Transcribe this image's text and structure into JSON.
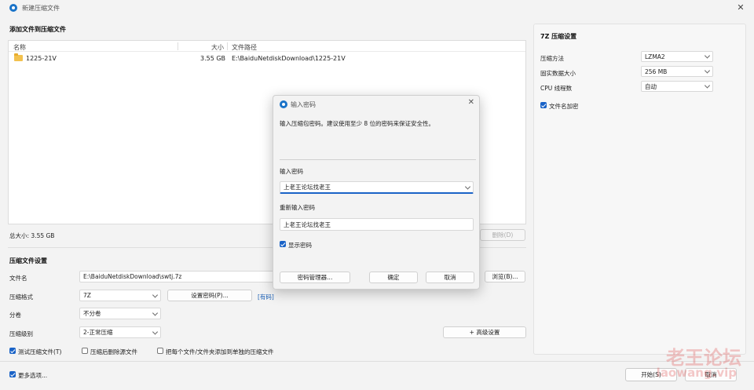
{
  "window": {
    "title": "新建压缩文件"
  },
  "file_section": {
    "title": "添加文件到压缩文件",
    "columns": {
      "name": "名称",
      "size": "大小",
      "path": "文件路径"
    },
    "rows": [
      {
        "name": "1225-21V",
        "size": "3.55 GB",
        "path": "E:\\BaiduNetdiskDownload\\1225-21V"
      }
    ],
    "total_size": "总大小: 3.55 GB",
    "delete_button": "删除(D)"
  },
  "archive_settings": {
    "title": "压缩文件设置",
    "filename_label": "文件名",
    "filename_value": "E:\\BaiduNetdiskDownload\\swtj.7z",
    "browse_button": "浏览(B)...",
    "format_label": "压缩格式",
    "format_value": "7Z",
    "set_password_button": "设置密码(P)...",
    "encrypted_tag": "[有码]",
    "volume_label": "分卷",
    "volume_value": "不分卷",
    "level_label": "压缩级别",
    "level_value": "2-正常压缩",
    "advanced_button": "+ 高级设置",
    "options": [
      {
        "label": "测试压缩文件(T)",
        "checked": true
      },
      {
        "label": "压缩后删除源文件",
        "checked": false
      },
      {
        "label": "把每个文件/文件夹添加到单独的压缩文件",
        "checked": false
      }
    ],
    "more_options": "更多选项..."
  },
  "footer": {
    "start_button": "开始(S)",
    "cancel_button": "取消"
  },
  "right_panel": {
    "title": "7Z 压缩设置",
    "rows": [
      {
        "label": "压缩方法",
        "value": "LZMA2"
      },
      {
        "label": "固实数据大小",
        "value": "256 MB"
      },
      {
        "label": "CPU 线程数",
        "value": "自动"
      }
    ],
    "encrypt_names_label": "文件名加密",
    "encrypt_names_checked": true
  },
  "password_dialog": {
    "title": "输入密码",
    "hint": "输入压缩包密码。建议使用至少 8 位的密码来保证安全性。",
    "password_label": "输入密码",
    "password_value": "上老王论坛找老王",
    "confirm_label": "重新输入密码",
    "confirm_value": "上老王论坛找老王",
    "show_password_label": "显示密码",
    "show_password_checked": true,
    "manager_button": "密码管理器...",
    "ok_button": "确定",
    "cancel_button": "取消"
  },
  "watermark": {
    "cn": "老王论坛",
    "url": "laowang.vip"
  },
  "colors": {
    "accent": "#1a63c7",
    "window_bg": "#f3f3f3",
    "panel_bg": "#f7f7f7"
  }
}
